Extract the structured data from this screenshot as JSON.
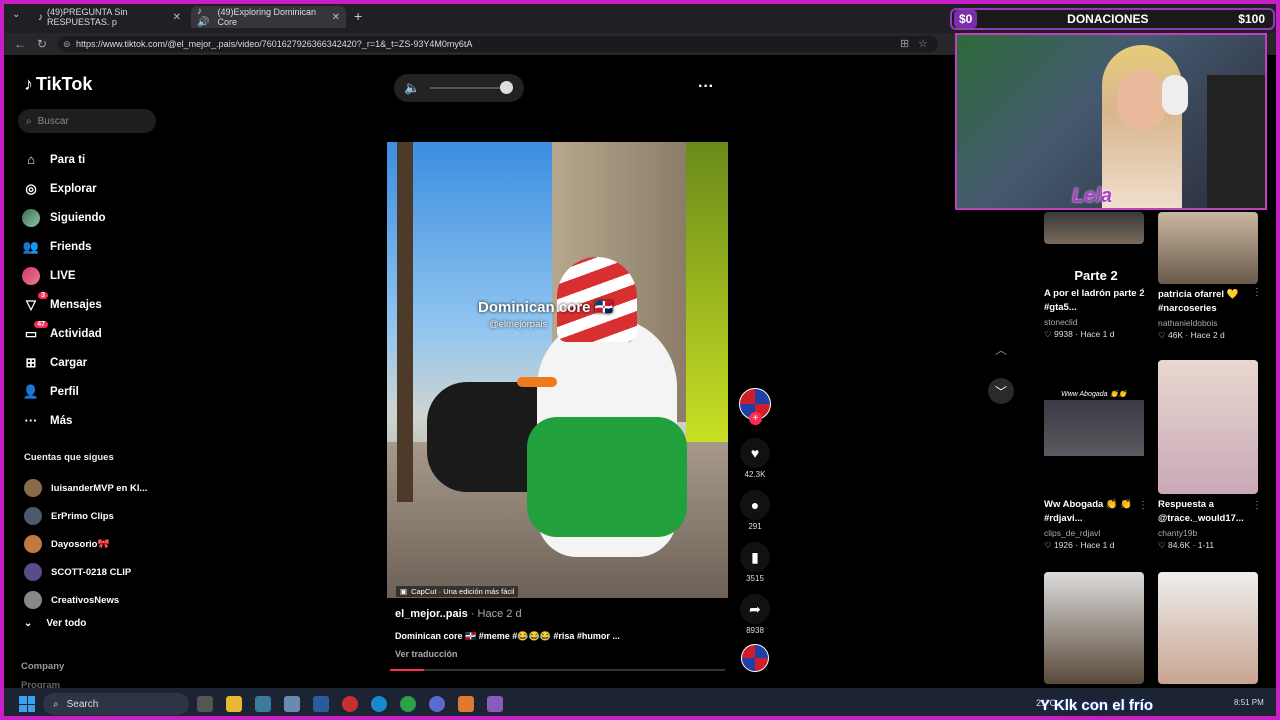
{
  "browser": {
    "tabs": [
      {
        "title": "(49)PREGUNTA Sin RESPUESTAS. p"
      },
      {
        "title": "(49)Exploring Dominican Core"
      }
    ],
    "url": "https://www.tiktok.com/@el_mejor_.pais/video/7601627926366342420?_r=1&_t=ZS-93Y4M0my6tA"
  },
  "donations": {
    "left": "$0",
    "label": "DONACIONES",
    "right": "$100"
  },
  "tiktok": {
    "logo": "TikTok",
    "search_placeholder": "Buscar",
    "menu": [
      {
        "label": "Para ti",
        "icon": "home-icon"
      },
      {
        "label": "Explorar",
        "icon": "compass-icon"
      },
      {
        "label": "Siguiendo",
        "icon": "following-avatar-icon"
      },
      {
        "label": "Friends",
        "icon": "friends-icon"
      },
      {
        "label": "LIVE",
        "icon": "live-icon"
      },
      {
        "label": "Mensajes",
        "icon": "messages-icon",
        "badge": "3"
      },
      {
        "label": "Actividad",
        "icon": "activity-icon",
        "badge": "47"
      },
      {
        "label": "Cargar",
        "icon": "upload-icon"
      },
      {
        "label": "Perfil",
        "icon": "profile-icon"
      },
      {
        "label": "Más",
        "icon": "more-icon"
      }
    ],
    "following_title": "Cuentas que sigues",
    "following": [
      {
        "name": "luisanderMVP en Kl...",
        "color": "#8a6a4a"
      },
      {
        "name": "ErPrimo Clips",
        "color": "#4a5a6a"
      },
      {
        "name": "Dayosorio🎀",
        "color": "#c07a40"
      },
      {
        "name": "SCOTT-0218 CLIP",
        "color": "#5a4a8a"
      },
      {
        "name": "CreativosNews",
        "color": "#888888"
      }
    ],
    "see_all": "Ver todo",
    "company": "Company",
    "program": "Program"
  },
  "video": {
    "overlay_title": "Dominican core 🇩🇴",
    "overlay_handle": "@elmejorpais",
    "capcut": "CapCut · Una edición más fácil",
    "author": "el_mejor..pais",
    "ago": " · Hace 2 d",
    "caption": "Dominican core 🇩🇴 #meme #😂😂😂 #risa #humor ...",
    "translate": "Ver traducción",
    "progress": 0.1,
    "likes": "42.3K",
    "comments": "291",
    "saves": "3515",
    "shares": "8938"
  },
  "cam": {
    "brand": "Lela"
  },
  "grid": [
    {
      "title": "A por el ladrón parte 2 #gta5...",
      "user": "stoneclid",
      "stats": "♡ 9938 · Hace 1 d",
      "overlay": "Parte 2"
    },
    {
      "title": "patricia ofarrel 💛 #narcoseries",
      "user": "nathanieldobois",
      "stats": "♡ 46K · Hace 2 d"
    },
    {
      "title": "Ww Abogada 👏 👏#rdjavi...",
      "user": "clips_de_rdjavl",
      "stats": "♡ 1926 · Hace 1 d",
      "overlay": "Www Abogada 👏👏"
    },
    {
      "title": "Respuesta a @trace._would17...",
      "user": "chanty19b",
      "stats": "♡ 84.6K · 1-11"
    }
  ],
  "taskbar": {
    "search": "Search",
    "weather": "21°C",
    "time": "8:51 PM"
  },
  "overlay_text": "Y Klk con el frío"
}
